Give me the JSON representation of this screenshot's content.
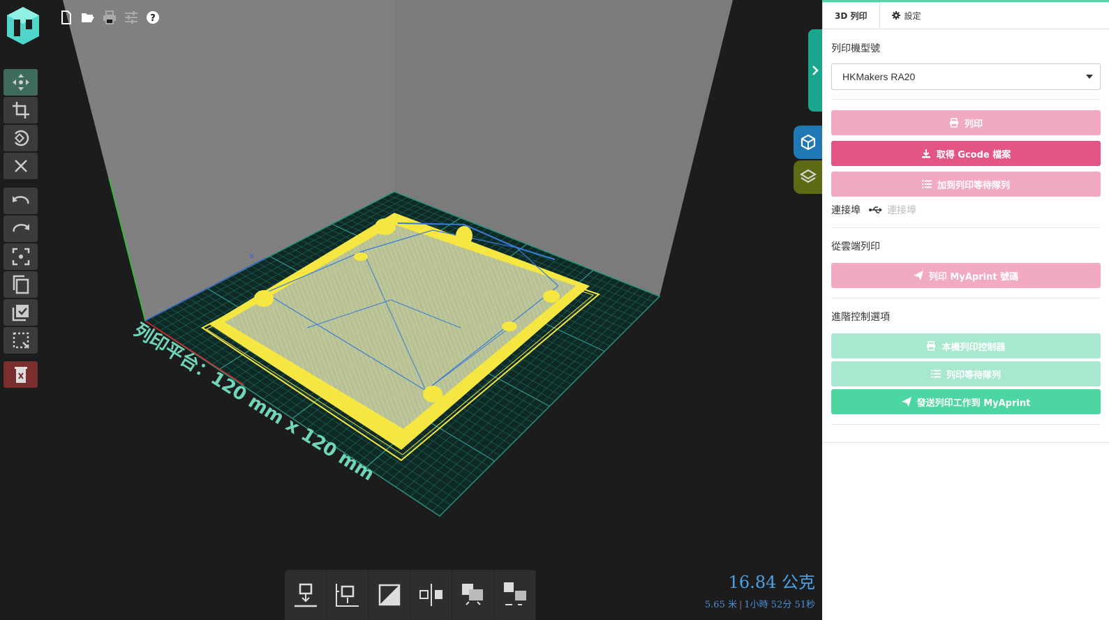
{
  "toolbar_top": {
    "icons": [
      "new-file-icon",
      "open-folder-icon",
      "print-icon",
      "settings-sliders-icon",
      "help-icon"
    ]
  },
  "left_toolbar": {
    "tools": [
      "move-icon",
      "scale-icon",
      "rotate-icon",
      "close-icon"
    ],
    "history": [
      "undo-icon",
      "redo-icon",
      "center-icon",
      "duplicate-icon",
      "select-all-icon",
      "deselect-icon"
    ],
    "danger": "delete-icon"
  },
  "viewport": {
    "platform_label": "列印平台：120 mm x 120 mm",
    "axis_x_label": "x"
  },
  "bottom_toolbar": {
    "icons": [
      "lay-flat-icon",
      "drop-to-bed-icon",
      "mirror-icon",
      "align-icon",
      "merge-icon",
      "split-icon"
    ]
  },
  "stats": {
    "weight": "16.84 公克",
    "length": "5.65 米",
    "separator": "|",
    "time": "1小時 52分 51秒"
  },
  "panel": {
    "tabs": [
      {
        "label": "3D 列印"
      },
      {
        "label": "設定"
      }
    ],
    "printer_model_label": "列印機型號",
    "printer_model_value": "HKMakers RA20",
    "print_button": "列印",
    "gcode_button": "取得 Gcode 檔案",
    "queue_button": "加到列印等待隊列",
    "port_label": "連接埠",
    "port_value": "連接埠",
    "cloud_label": "從雲端列印",
    "cloud_button": "列印 MyAprint 號碼",
    "advanced_label": "進階控制選項",
    "local_controller_button": "本機列印控制器",
    "print_queue_button": "列印等待隊列",
    "send_myaprint_button": "發送列印工作到 MyAprint"
  },
  "colors": {
    "accent": "#4cd8a6",
    "pink": "#e35585",
    "pink_light": "#f2aac2",
    "green": "#4cd6a2",
    "green_light": "#a8e8cf",
    "model_yellow": "#f5e642",
    "travel_blue": "#3a7bd5",
    "grid_teal": "#1f6b5e"
  }
}
